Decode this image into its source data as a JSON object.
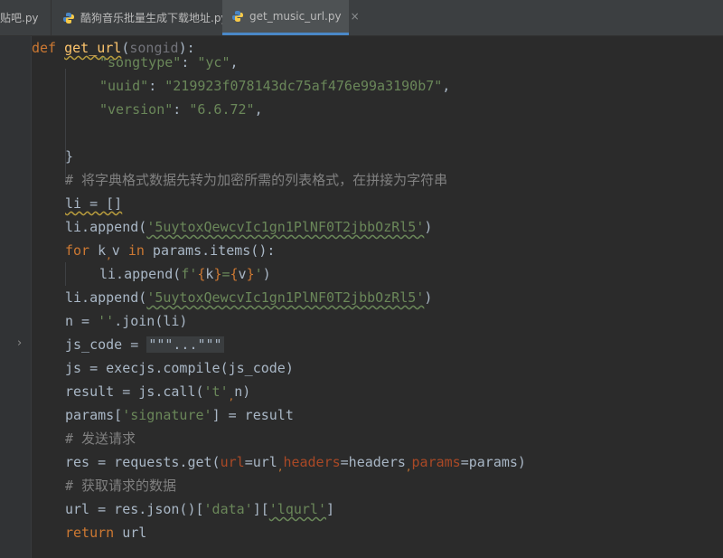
{
  "tabs": [
    {
      "label": "贴吧.py"
    },
    {
      "label": "酷狗音乐批量生成下载地址.py"
    },
    {
      "label": "get_music_url.py",
      "close": "×"
    }
  ],
  "code": {
    "l0_def": "def",
    "l0_name": "get_url",
    "l0_open": "(",
    "l0_param": "songid",
    "l0_close": "):",
    "l1_key": "\"songtype\"",
    "l1_colon": ": ",
    "l1_val": "\"yc\"",
    "l1_end": ",",
    "l2_key": "\"uuid\"",
    "l2_colon": ": ",
    "l2_val": "\"219923f078143dc75af476e99a3190b7\"",
    "l2_end": ",",
    "l3_key": "\"version\"",
    "l3_colon": ": ",
    "l3_val": "\"6.6.72\"",
    "l3_end": ",",
    "l5_brace": "}",
    "l6_comment": "# 将字典格式数据先转为加密所需的列表格式，在拼接为字符串",
    "l7_a": "li = []",
    "l8_a": "li.append(",
    "l8_s": "'5uytoxQewcvIc1gn1PlNF0T2jbbOzRl5'",
    "l8_b": ")",
    "l9_for": "for",
    "l9_a": " k",
    "l9_comma": ",",
    "l9_b": "v ",
    "l9_in": "in",
    "l9_c": " params.items():",
    "l10_a": "li.append(",
    "l10_f": "f'",
    "l10_b1": "{",
    "l10_k": "k",
    "l10_b2": "}",
    "l10_eq": "=",
    "l10_b3": "{",
    "l10_v": "v",
    "l10_b4": "}",
    "l10_q": "'",
    "l10_c": ")",
    "l11_a": "li.append(",
    "l11_s": "'5uytoxQewcvIc1gn1PlNF0T2jbbOzRl5'",
    "l11_b": ")",
    "l12_a": "n = ",
    "l12_s": "''",
    "l12_b": ".join(li)",
    "l13_a": "js_code = ",
    "l13_fold": "\"\"\"...\"\"\"",
    "l14_a": "js = execjs.compile(js_code)",
    "l15_a": "result = js.call(",
    "l15_s": "'t'",
    "l15_comma": ",",
    "l15_b": "n)",
    "l16_a": "params[",
    "l16_s": "'signature'",
    "l16_b": "] = result",
    "l17_comment": "# 发送请求",
    "l18_a": "res = requests.get(",
    "l18_p1": "url",
    "l18_b": "=url",
    "l18_c1": ",",
    "l18_p2": "headers",
    "l18_c": "=headers",
    "l18_c2": ",",
    "l18_p3": "params",
    "l18_d": "=params)",
    "l19_comment": "# 获取请求的数据",
    "l20_a": "url = res.json()[",
    "l20_s1": "'data'",
    "l20_b": "][",
    "l20_s2": "'lqurl'",
    "l20_c": "]",
    "l21_kw": "return",
    "l21_a": " url"
  },
  "colors": {
    "background": "#2b2b2b",
    "keyword": "#cc7832",
    "function": "#ffc66d",
    "string": "#6a8759",
    "comment": "#808080",
    "param": "#aa4926",
    "text": "#a9b7c6",
    "tab_active_underline": "#4a88c7"
  }
}
